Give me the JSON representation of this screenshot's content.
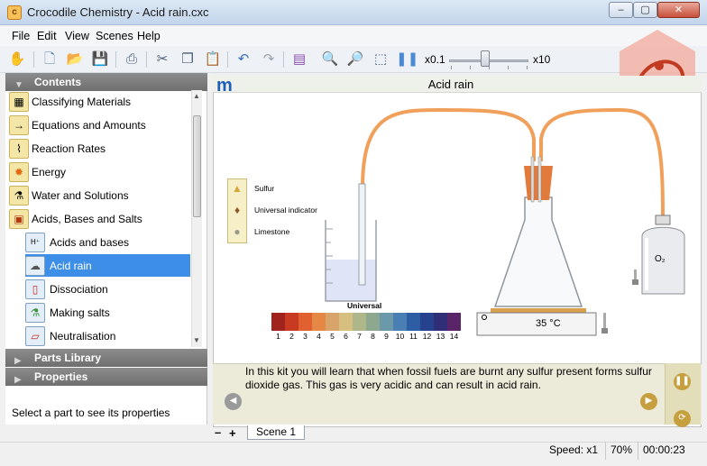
{
  "window": {
    "title": "Crocodile Chemistry - Acid rain.cxc",
    "app_icon_letter": "c",
    "min": "–",
    "max": "▢",
    "close": "✕"
  },
  "menu": [
    "File",
    "Edit",
    "View",
    "Scenes",
    "Help"
  ],
  "toolbar": {
    "icons": [
      "hand-icon",
      "new-file-icon",
      "open-folder-icon",
      "save-icon",
      "print-icon",
      "cut-icon",
      "copy-icon",
      "paste-icon",
      "undo-icon",
      "redo-icon",
      "measure-icon",
      "zoom-in-icon",
      "zoom-out-icon",
      "zoom-area-icon",
      "pause-icon"
    ],
    "speed_min": "x0.1",
    "speed_max": "x10",
    "speed_value_fraction": 0.45
  },
  "contents": {
    "heading": "Contents",
    "topics": [
      {
        "label": "Classifying Materials",
        "icon": "▦"
      },
      {
        "label": "Equations and Amounts",
        "icon": "→"
      },
      {
        "label": "Reaction Rates",
        "icon": "⌇"
      },
      {
        "label": "Energy",
        "icon": "✹"
      },
      {
        "label": "Water and Solutions",
        "icon": "⚗"
      },
      {
        "label": "Acids, Bases and Salts",
        "icon": "▣"
      }
    ],
    "subtopics": [
      {
        "label": "Acids and bases",
        "icon": "H⁺",
        "selected": false
      },
      {
        "label": "Acid rain",
        "icon": "☁",
        "selected": true
      },
      {
        "label": "Dissociation",
        "icon": "▯",
        "selected": false
      },
      {
        "label": "Making salts",
        "icon": "⚗",
        "selected": false
      },
      {
        "label": "Neutralisation",
        "icon": "▱",
        "selected": false
      }
    ]
  },
  "parts_library": {
    "heading": "Parts Library"
  },
  "properties": {
    "heading": "Properties",
    "hint": "Select a part to see its properties"
  },
  "scene": {
    "logo_letter": "m",
    "title": "Acid rain",
    "palette": [
      {
        "label": "Sulfur",
        "icon": "▲"
      },
      {
        "label": "Universal indicator",
        "icon": "♦"
      },
      {
        "label": "Limestone",
        "icon": "●"
      }
    ],
    "scale_title": "Universal",
    "scale_numbers": [
      "1",
      "2",
      "3",
      "4",
      "5",
      "6",
      "7",
      "8",
      "9",
      "10",
      "11",
      "12",
      "13",
      "14"
    ],
    "scale_colors": [
      "#a0241d",
      "#c93a22",
      "#e0602f",
      "#e58845",
      "#d9a46a",
      "#d7bf80",
      "#aeb78a",
      "#8ea88f",
      "#6b99a9",
      "#4a7fb3",
      "#2d5ea3",
      "#26428f",
      "#312e78",
      "#5a2469"
    ],
    "temperature": "35 °C",
    "gas_label": "O₂"
  },
  "info": {
    "text": "In this kit you will learn that when fossil fuels are burnt any sulfur present forms sulfur dioxide gas. This gas is very acidic and can result in acid rain."
  },
  "scene_tabs": {
    "minus": "–",
    "plus": "+",
    "tab": "Scene 1"
  },
  "status": {
    "speed": "Speed: x1",
    "zoom": "70%",
    "time": "00:00:23"
  }
}
